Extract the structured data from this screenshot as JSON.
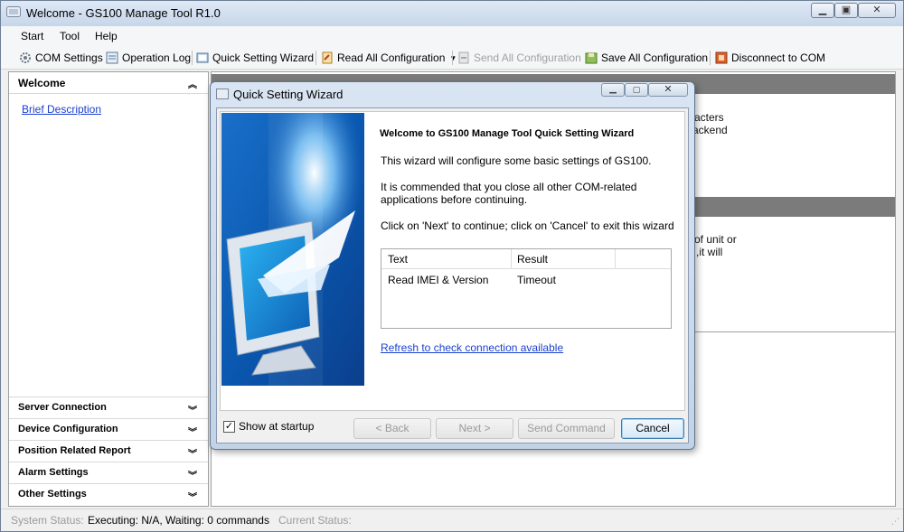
{
  "window": {
    "title": "Welcome - GS100 Manage Tool R1.0"
  },
  "menu": [
    "Start",
    "Tool",
    "Help"
  ],
  "toolbar": {
    "com_settings": "COM Settings",
    "operation_log": "Operation Log",
    "quick_wizard": "Quick Setting Wizard",
    "read_all": "Read All Configuration",
    "send_all": "Send All Configuration",
    "save_all": "Save All Configuration",
    "disconnect": "Disconnect to COM"
  },
  "sidebar": {
    "header": "Welcome",
    "link": "Brief Description",
    "sections": [
      "Server Connection",
      "Device Configuration",
      "Position Related Report",
      "Alarm Settings",
      "Other Settings"
    ]
  },
  "background_text": {
    "line1": "racters",
    "line2": "ackend",
    "line3": "of unit or",
    "line4": ",it will"
  },
  "dialog": {
    "title": "Quick Setting Wizard",
    "heading": "Welcome to GS100 Manage Tool  Quick Setting Wizard",
    "para1": "This wizard will configure some basic settings of GS100.",
    "para2": "It is commended that you close all other COM-related applications before continuing.",
    "para3": "Click on 'Next' to continue; click on 'Cancel' to exit this wizard",
    "table": {
      "headers": [
        "Text",
        "Result"
      ],
      "rows": [
        [
          "Read IMEI & Version",
          "Timeout"
        ]
      ]
    },
    "refresh_link": "Refresh to check connection available",
    "show_at_startup": "Show at startup",
    "show_at_startup_checked": true,
    "buttons": {
      "back": "< Back",
      "next": "Next >",
      "send": "Send Command",
      "cancel": "Cancel"
    }
  },
  "status": {
    "system_label": "System Status:",
    "executing": "Executing: N/A, Waiting: 0 commands",
    "current_label": "Current Status:"
  }
}
